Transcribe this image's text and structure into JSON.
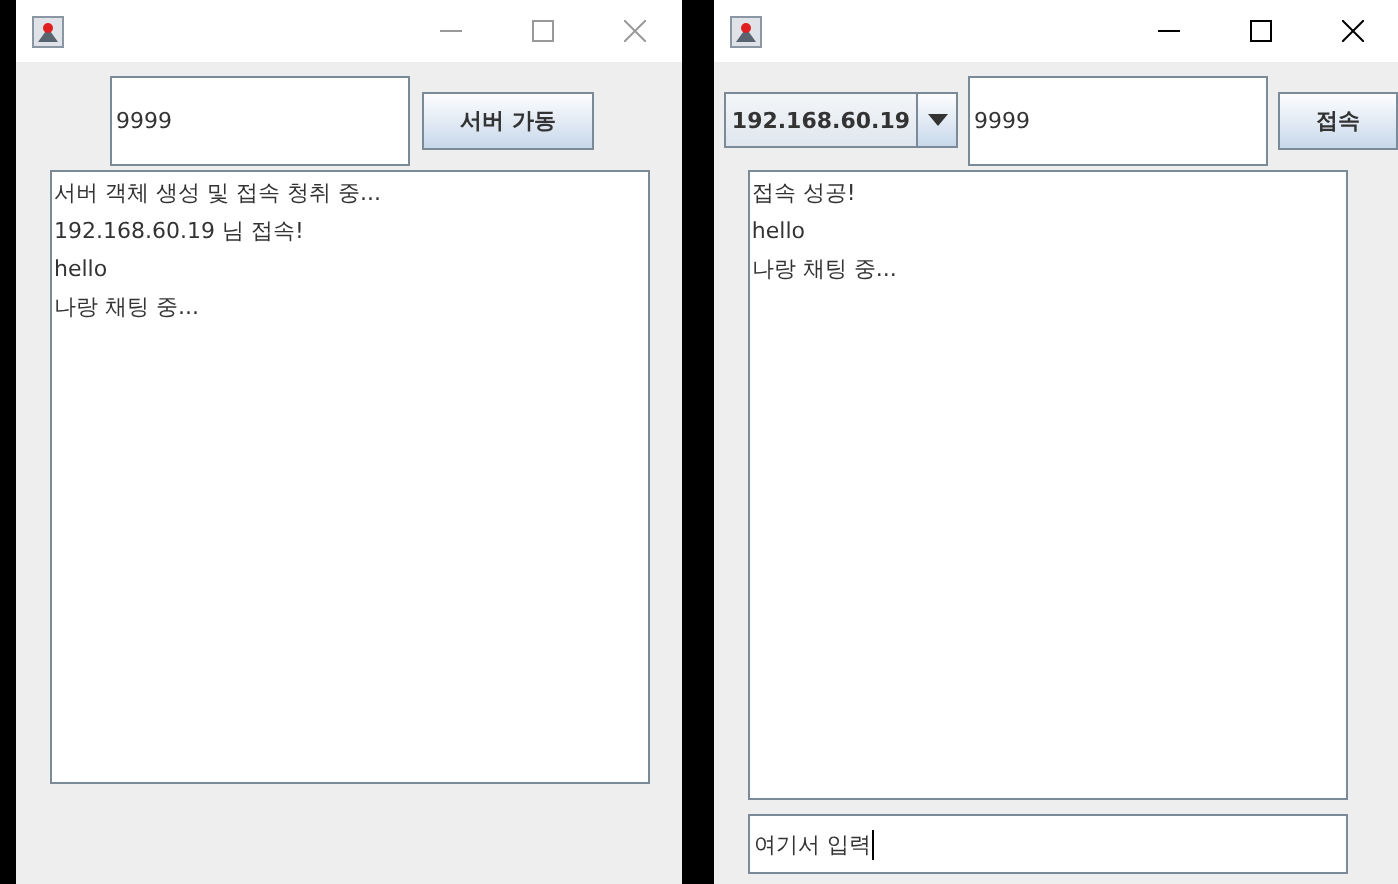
{
  "windows": [
    {
      "kind": "server",
      "active": false,
      "port_field": {
        "value": "9999"
      },
      "button": "서버 가동",
      "log": [
        "서버 객체 생성 및 접속 청취 중...",
        "192.168.60.19 님 접속!",
        "hello",
        "나랑 채팅 중..."
      ]
    },
    {
      "kind": "client",
      "active": true,
      "host_combo": {
        "value": "192.168.60.19"
      },
      "port_field": {
        "value": "9999"
      },
      "button": "접속",
      "log": [
        "접속 성공!",
        "hello",
        "나랑 채팅 중..."
      ],
      "message_field": {
        "value": "여기서 입력",
        "focused": true
      }
    }
  ]
}
